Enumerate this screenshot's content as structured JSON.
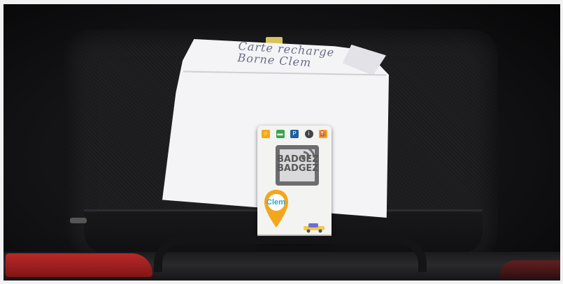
{
  "photo": {
    "note_lines": [
      "Carte recharge",
      "Borne Clem"
    ],
    "card": {
      "brand": "Clem",
      "badge_words": [
        "BADGEZ",
        "BADGEZ"
      ],
      "colors": {
        "accent_orange": "#f2a71d",
        "brand_blue": "#29a8e0",
        "card_gray": "#6d6d6f"
      }
    },
    "icons": [
      "charging-icon",
      "car-icon",
      "parking-icon",
      "info-icon",
      "pump-icon"
    ]
  }
}
